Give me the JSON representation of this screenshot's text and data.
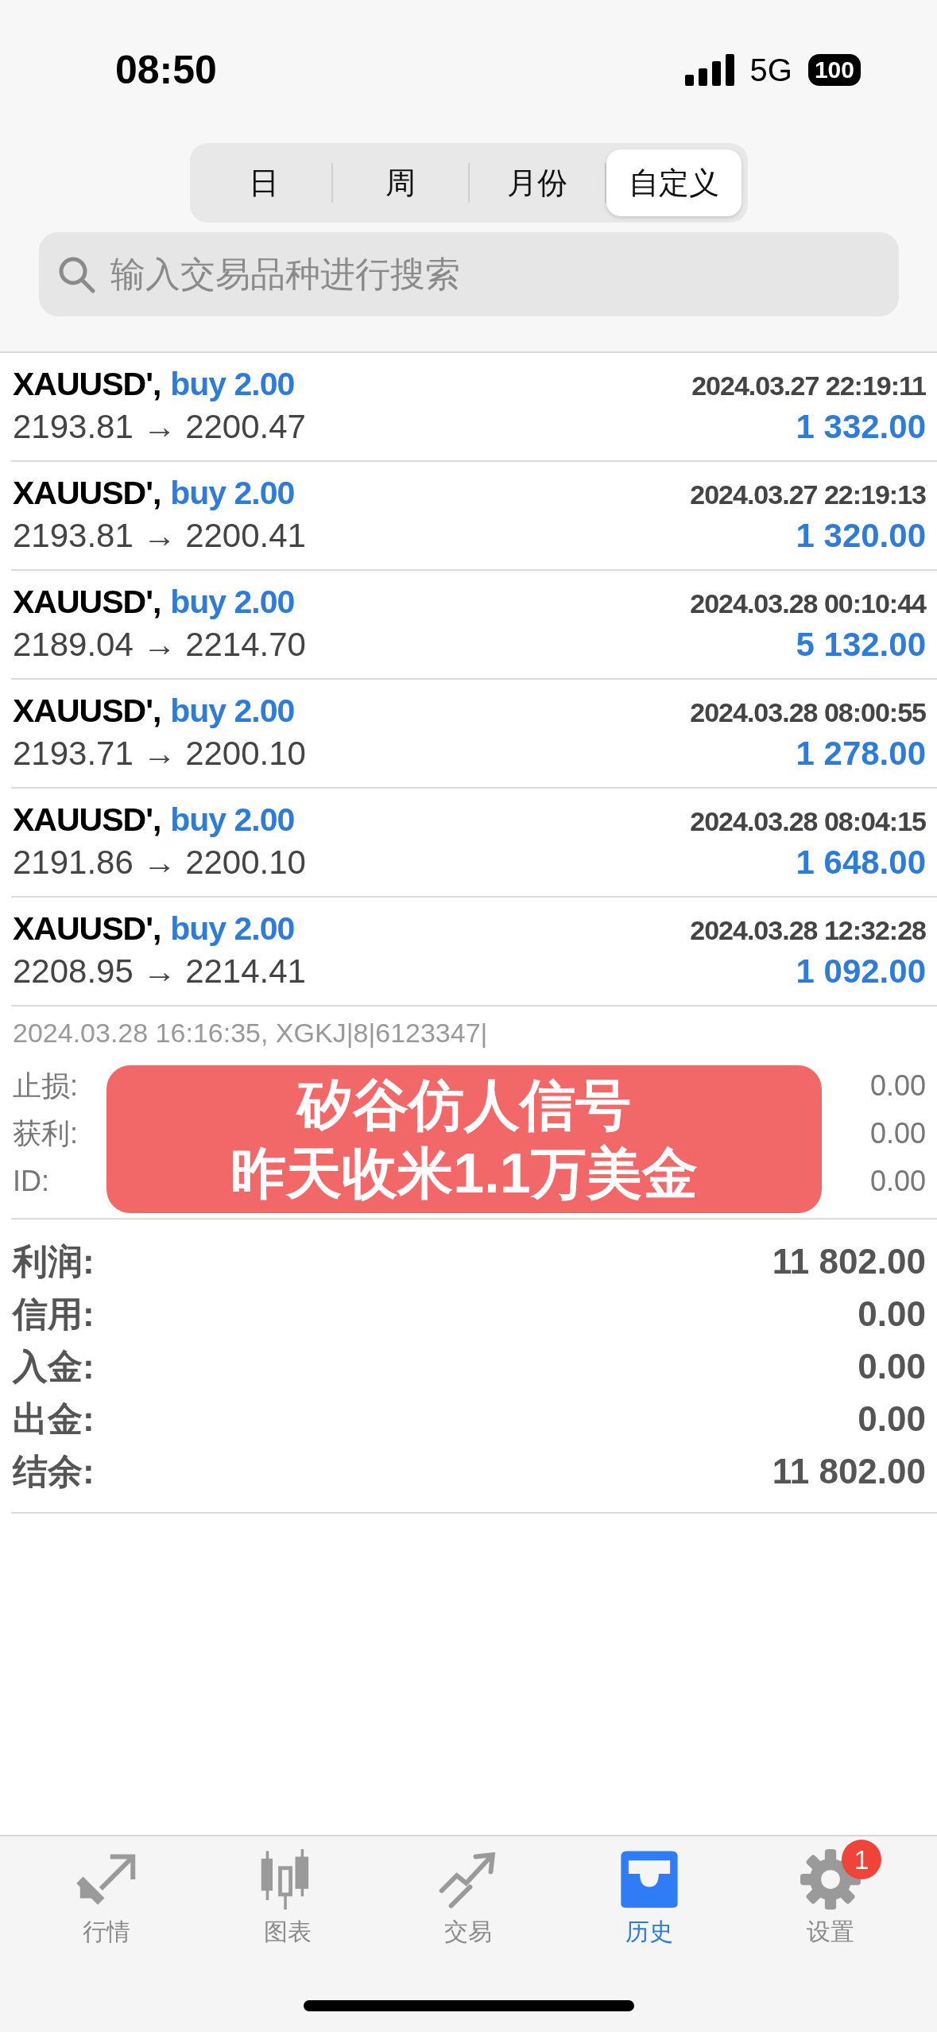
{
  "status_bar": {
    "time": "08:50",
    "network": "5G",
    "battery": "100"
  },
  "period_tabs": [
    {
      "label": "日",
      "selected": false
    },
    {
      "label": "周",
      "selected": false
    },
    {
      "label": "月份",
      "selected": false
    },
    {
      "label": "自定义",
      "selected": true
    }
  ],
  "search": {
    "placeholder": "输入交易品种进行搜索"
  },
  "deals": [
    {
      "symbol": "XAUUSD',",
      "action": "buy 2.00",
      "time": "2024.03.27 22:19:11",
      "prices": "2193.81 → 2200.47",
      "profit": "1 332.00"
    },
    {
      "symbol": "XAUUSD',",
      "action": "buy 2.00",
      "time": "2024.03.27 22:19:13",
      "prices": "2193.81 → 2200.41",
      "profit": "1 320.00"
    },
    {
      "symbol": "XAUUSD',",
      "action": "buy 2.00",
      "time": "2024.03.28 00:10:44",
      "prices": "2189.04 → 2214.70",
      "profit": "5 132.00"
    },
    {
      "symbol": "XAUUSD',",
      "action": "buy 2.00",
      "time": "2024.03.28 08:00:55",
      "prices": "2193.71 → 2200.10",
      "profit": "1 278.00"
    },
    {
      "symbol": "XAUUSD',",
      "action": "buy 2.00",
      "time": "2024.03.28 08:04:15",
      "prices": "2191.86 → 2200.10",
      "profit": "1 648.00"
    },
    {
      "symbol": "XAUUSD',",
      "action": "buy 2.00",
      "time": "2024.03.28 12:32:28",
      "prices": "2208.95 → 2214.41",
      "profit": "1 092.00"
    }
  ],
  "detail": {
    "header": "2024.03.28 16:16:35, XGKJ|8|6123347|",
    "rows": [
      {
        "label": "止损:",
        "value": "0.00"
      },
      {
        "label": "获利:",
        "value": "0.00"
      },
      {
        "label": "ID:",
        "value": "0.00"
      }
    ]
  },
  "overlay_banner": {
    "lines": [
      "矽谷仿人信号",
      "昨天收米1.1万美金"
    ]
  },
  "summary": [
    {
      "label": "利润:",
      "value": "11 802.00"
    },
    {
      "label": "信用:",
      "value": "0.00"
    },
    {
      "label": "入金:",
      "value": "0.00"
    },
    {
      "label": "出金:",
      "value": "0.00"
    },
    {
      "label": "结余:",
      "value": "11 802.00"
    }
  ],
  "tab_bar": [
    {
      "kind": "arrows",
      "label": "行情",
      "selected": false
    },
    {
      "kind": "candles",
      "label": "图表",
      "selected": false
    },
    {
      "kind": "trend",
      "label": "交易",
      "selected": false
    },
    {
      "kind": "inbox",
      "label": "历史",
      "selected": true
    },
    {
      "kind": "gear",
      "label": "设置",
      "selected": false,
      "badge": "1"
    }
  ]
}
